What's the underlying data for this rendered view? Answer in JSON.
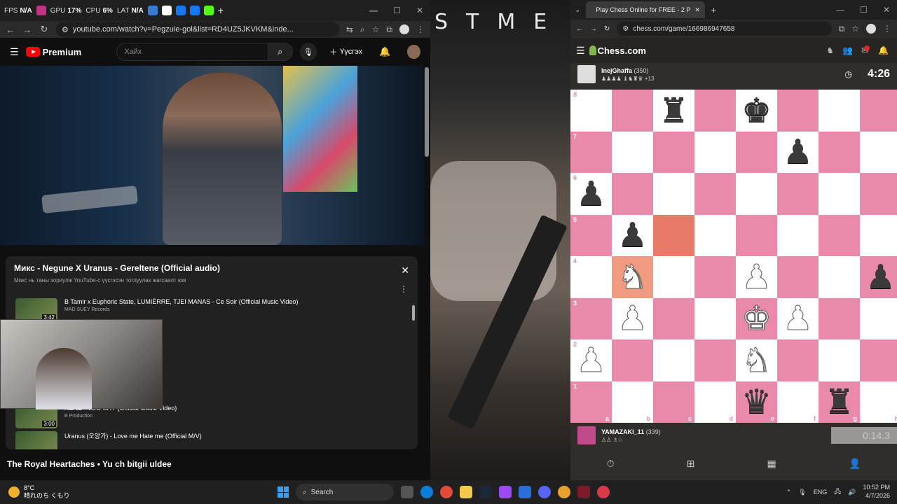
{
  "overlay": {
    "fps_label": "FPS",
    "fps_value": "N/A",
    "gpu_label": "GPU",
    "gpu_value": "17%",
    "cpu_label": "CPU",
    "cpu_value": "6%",
    "lat_label": "LAT",
    "lat_value": "N/A"
  },
  "yt_browser": {
    "url": "youtube.com/watch?v=Pegzuie-gol&list=RD4UZ5JKVKM&inde..."
  },
  "youtube": {
    "logo": "Premium",
    "search_placeholder": "Хайх",
    "create_label": "Үүсгэх",
    "panel_title": "Микс - Negune X Uranus - Gereltene (Official audio)",
    "panel_subtitle": "Микс нь таны зориулж YouTube-с үүсгэсэн тоглуулах жагсаалт юм",
    "playlist": [
      {
        "title": "B Tamir x Euphoric State, LUMIÈRRE, TJEI MANAS - Ce Soir (Official Music Video)",
        "channel": "MAD SUEY Records",
        "duration": "3:42"
      },
      {
        "title": "ial Music Video)",
        "channel": "",
        "duration": ""
      },
      {
        "title": "ric Video)",
        "channel": "",
        "duration": ""
      },
      {
        "title": "l. YungRhythm)",
        "channel": "",
        "duration": ""
      },
      {
        "title": "NENE - TOO SHY (Official Music Video)",
        "channel": "B Production",
        "duration": "3:00"
      },
      {
        "title": "Uranus (오앙가) - Love me Hate me (Official M/V)",
        "channel": "",
        "duration": ""
      }
    ],
    "next_title": "The Royal Heartaches • Yu ch bitgii uldee"
  },
  "chess_browser": {
    "tab_title": "Play Chess Online for FREE - 2 P",
    "url": "chess.com/game/166986947658"
  },
  "chess": {
    "logo": "Chess.com",
    "top_player": {
      "name": "InejGhaffa",
      "rating": "(350)",
      "captured": "+13",
      "clock": "4:26"
    },
    "bottom_player": {
      "name": "YAMAZAKI_11",
      "rating": "(339)",
      "clock": "0:14.3"
    },
    "ranks": [
      "8",
      "7",
      "6",
      "5",
      "4",
      "3",
      "2",
      "1"
    ],
    "files": [
      "a",
      "b",
      "c",
      "d",
      "e",
      "f",
      "g",
      "h"
    ],
    "board": [
      [
        "",
        "",
        "br",
        "",
        "bk",
        "",
        "",
        ""
      ],
      [
        "",
        "",
        "",
        "",
        "",
        "bp",
        "",
        ""
      ],
      [
        "bp",
        "",
        "",
        "",
        "",
        "",
        "",
        ""
      ],
      [
        "",
        "bp",
        "",
        "",
        "",
        "",
        "",
        ""
      ],
      [
        "",
        "wn",
        "",
        "",
        "wp",
        "",
        "",
        "bp"
      ],
      [
        "",
        "wp",
        "",
        "",
        "wk",
        "wp",
        "",
        ""
      ],
      [
        "wp",
        "",
        "",
        "",
        "wn",
        "",
        "",
        ""
      ],
      [
        "",
        "",
        "",
        "",
        "bq",
        "",
        "br",
        ""
      ]
    ],
    "highlight": [
      "c5",
      "b4"
    ]
  },
  "taskbar": {
    "temp": "8°C",
    "weather": "晴れのち くもり",
    "search": "Search",
    "lang": "ENG",
    "time": "10:52 PM",
    "date": "4/7/2026"
  }
}
